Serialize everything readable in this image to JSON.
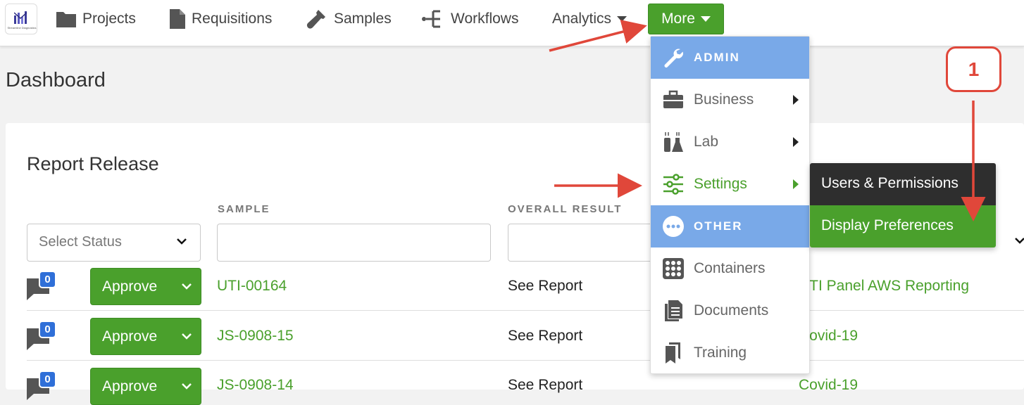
{
  "nav": {
    "logo_caption": "Streamline Diagnostics",
    "projects": "Projects",
    "requisitions": "Requisitions",
    "samples": "Samples",
    "workflows": "Workflows",
    "analytics": "Analytics",
    "more": "More"
  },
  "page_title": "Dashboard",
  "report_release": {
    "title": "Report Release",
    "col_sample": "SAMPLE",
    "col_overall": "OVERALL RESULT",
    "status_placeholder": "Select Status",
    "approve_label": "Approve",
    "rows": [
      {
        "count": "0",
        "sample": "UTI-00164",
        "result": "See Report",
        "panel": "UTI Panel AWS Reporting"
      },
      {
        "count": "0",
        "sample": "JS-0908-15",
        "result": "See Report",
        "panel": "Covid-19"
      },
      {
        "count": "0",
        "sample": "JS-0908-14",
        "result": "See Report",
        "panel": "Covid-19"
      }
    ]
  },
  "menu": {
    "admin": "ADMIN",
    "business": "Business",
    "lab": "Lab",
    "settings": "Settings",
    "other": "OTHER",
    "containers": "Containers",
    "documents": "Documents",
    "training": "Training"
  },
  "submenu": {
    "users": "Users & Permissions",
    "display": "Display Preferences"
  },
  "callout_number": "1",
  "colors": {
    "accent_green": "#4aa02c",
    "section_blue": "#79a9e8",
    "annotation_red": "#e0473a",
    "badge_blue": "#2f6fd8"
  }
}
